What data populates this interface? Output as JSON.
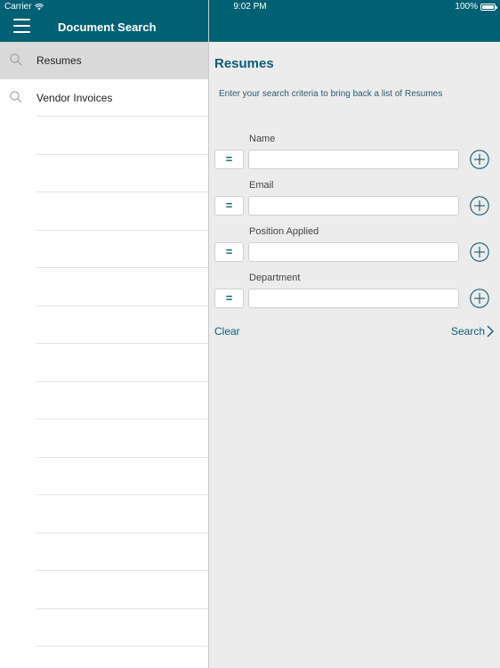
{
  "status_bar": {
    "carrier": "Carrier",
    "time": "9:02 PM",
    "battery": "100%"
  },
  "left_pane": {
    "title": "Document Search",
    "items": [
      {
        "label": "Resumes",
        "icon": "search-icon",
        "selected": true
      },
      {
        "label": "Vendor Invoices",
        "icon": "search-icon",
        "selected": false
      }
    ]
  },
  "right_pane": {
    "title": "Resumes",
    "instructions": "Enter your search criteria to bring back a list of Resumes",
    "fields": [
      {
        "label": "Name",
        "operator": "=",
        "value": ""
      },
      {
        "label": "Email",
        "operator": "=",
        "value": ""
      },
      {
        "label": "Position Applied",
        "operator": "=",
        "value": ""
      },
      {
        "label": "Department",
        "operator": "=",
        "value": ""
      }
    ],
    "clear_label": "Clear",
    "search_label": "Search"
  },
  "colors": {
    "header_bg": "#006074",
    "accent": "#0e5d74",
    "selected_row": "#d9d9d9"
  }
}
